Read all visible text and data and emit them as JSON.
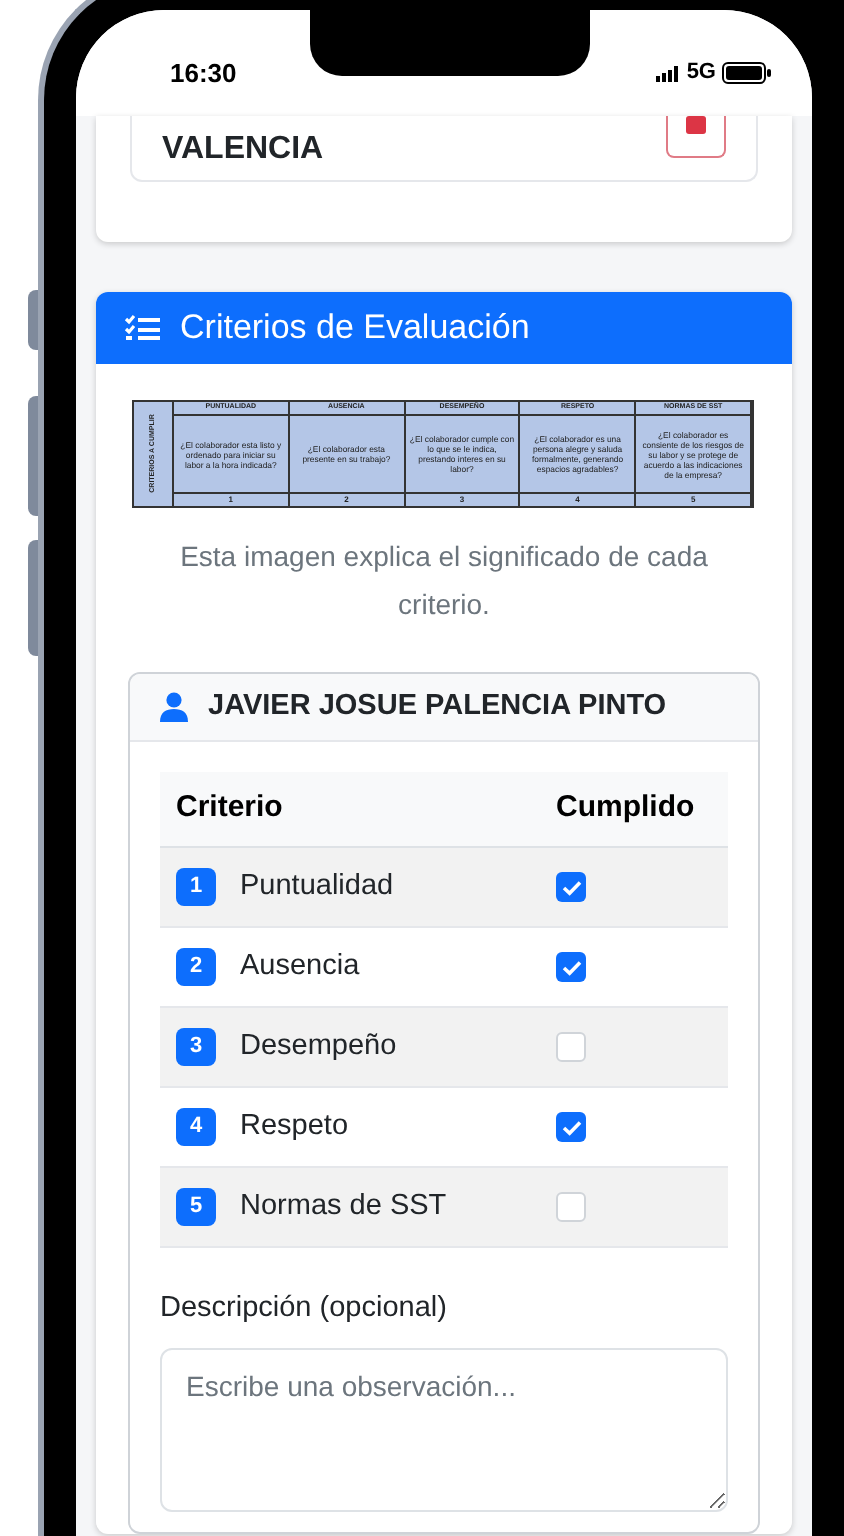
{
  "status_bar": {
    "time": "16:30",
    "network": "5G"
  },
  "location_card": {
    "city": "VALENCIA"
  },
  "criteria_panel": {
    "title": "Criterios de Evaluación",
    "reference_table": {
      "side_label": "CRITERIOS A CUMPLIR",
      "columns": [
        {
          "heading": "PUNTUALIDAD",
          "question": "¿El colaborador esta listo y ordenado para iniciar su labor a la hora indicada?",
          "number": "1"
        },
        {
          "heading": "AUSENCIA",
          "question": "¿El colaborador esta presente en su trabajo?",
          "number": "2"
        },
        {
          "heading": "DESEMPEÑO",
          "question": "¿El colaborador cumple con lo que se le indica, prestando interes en su labor?",
          "number": "3"
        },
        {
          "heading": "RESPETO",
          "question": "¿El colaborador es una persona alegre y saluda formalmente, generando espacios agradables?",
          "number": "4"
        },
        {
          "heading": "NORMAS DE SST",
          "question": "¿El colaborador es consiente de los riesgos de su labor y se protege de acuerdo a las indicaciones de la empresa?",
          "number": "5"
        }
      ]
    },
    "caption": "Esta imagen explica el significado de cada criterio.",
    "employee": {
      "name": "JAVIER JOSUE PALENCIA PINTO",
      "columns": [
        "Criterio",
        "Cumplido"
      ],
      "rows": [
        {
          "number": "1",
          "label": "Puntualidad",
          "checked": true
        },
        {
          "number": "2",
          "label": "Ausencia",
          "checked": true
        },
        {
          "number": "3",
          "label": "Desempeño",
          "checked": false
        },
        {
          "number": "4",
          "label": "Respeto",
          "checked": true
        },
        {
          "number": "5",
          "label": "Normas de SST",
          "checked": false
        }
      ],
      "description": {
        "label": "Descripción (opcional)",
        "placeholder": "Escribe una observación..."
      }
    }
  }
}
